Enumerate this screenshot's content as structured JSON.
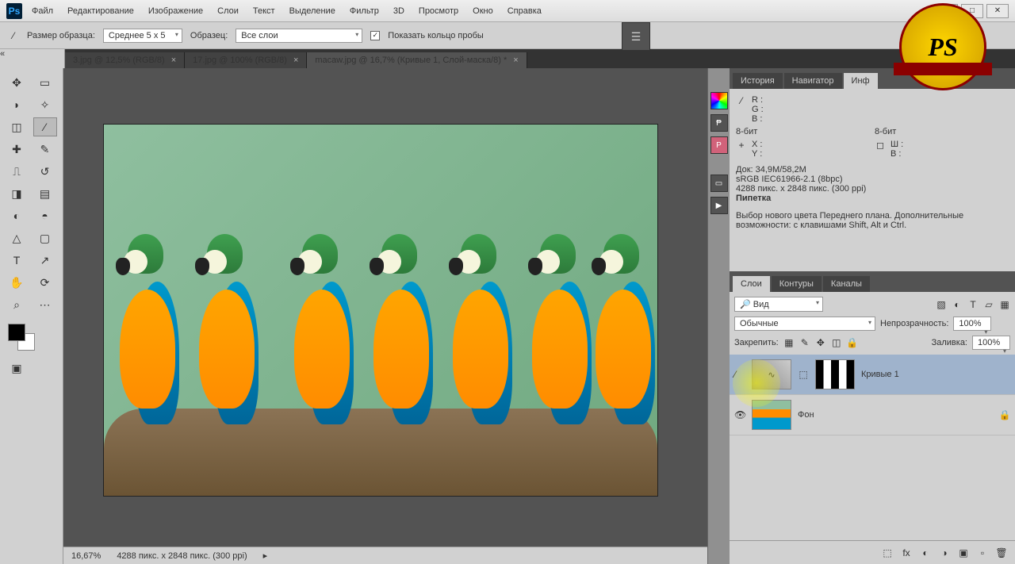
{
  "menu": {
    "items": [
      "Файл",
      "Редактирование",
      "Изображение",
      "Слои",
      "Текст",
      "Выделение",
      "Фильтр",
      "3D",
      "Просмотр",
      "Окно",
      "Справка"
    ]
  },
  "windowControls": {
    "min": "—",
    "max": "□",
    "close": "✕"
  },
  "optionsBar": {
    "sampleSizeLabel": "Размер образца:",
    "sampleSizeValue": "Среднее 5 x 5",
    "sampleLabel": "Образец:",
    "sampleValue": "Все слои",
    "showRingLabel": "Показать кольцо пробы",
    "showRingChecked": "✓"
  },
  "docTabs": [
    {
      "label": "3.jpg @ 12,5% (RGB/8)",
      "active": false
    },
    {
      "label": "17.jpg @ 100% (RGB/8)",
      "active": false
    },
    {
      "label": "macaw.jpg @ 16,7% (Кривые 1, Слой-маска/8) *",
      "active": true
    }
  ],
  "statusBar": {
    "zoom": "16,67%",
    "dims": "4288 пикс. x 2848 пикс. (300 ppi)"
  },
  "panel1": {
    "tabs": [
      "История",
      "Навигатор",
      "Инф"
    ],
    "activeTab": 2,
    "rgb": {
      "r": "R :",
      "g": "G :",
      "b": "B :"
    },
    "bit": "8-бит",
    "bit2": "8-бит",
    "xy": {
      "x": "X :",
      "y": "Y :"
    },
    "wh": {
      "w": "Ш :",
      "h": "В :"
    },
    "doc": "Док: 34,9M/58,2M",
    "profile": "sRGB IEC61966-2.1 (8bpc)",
    "size": "4288 пикс. x 2848 пикс. (300 ppi)",
    "tool": "Пипетка",
    "hint": "Выбор нового цвета Переднего плана. Дополнительные возможности: с клавишами Shift, Alt и Ctrl."
  },
  "layersPanel": {
    "tabs": [
      "Слои",
      "Контуры",
      "Каналы"
    ],
    "activeTab": 0,
    "kind": "Вид",
    "blend": "Обычные",
    "opacityLabel": "Непрозрачность:",
    "opacityVal": "100%",
    "lockLabel": "Закрепить:",
    "fillLabel": "Заливка:",
    "fillVal": "100%",
    "layers": [
      {
        "name": "Кривые 1",
        "locked": false,
        "adjustment": true
      },
      {
        "name": "Фон",
        "locked": true,
        "adjustment": false
      }
    ]
  },
  "badge": "PS"
}
